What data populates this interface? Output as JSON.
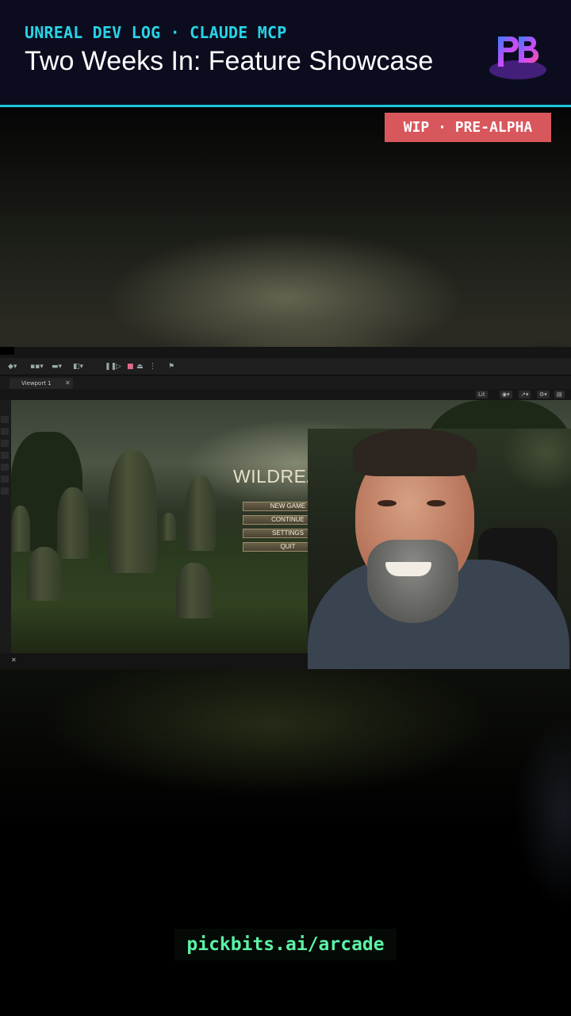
{
  "header": {
    "kicker": "UNREAL DEV LOG · CLAUDE MCP",
    "title": "Two Weeks In: Feature Showcase",
    "logo_text": "PB"
  },
  "badge": {
    "label": "WIP · PRE-ALPHA"
  },
  "editor": {
    "tab_label": "Viewport 1",
    "viewport_controls": [
      "Lit"
    ],
    "game": {
      "title": "WILDREACH",
      "menu": [
        "NEW GAME",
        "CONTINUE",
        "SETTINGS",
        "QUIT"
      ]
    }
  },
  "footer": {
    "url": "pickbits.ai/arcade"
  },
  "colors": {
    "accent": "#27d4e6",
    "badge": "#d8575d",
    "url": "#5cf2a5",
    "header_bg": "#0b0d1f"
  }
}
